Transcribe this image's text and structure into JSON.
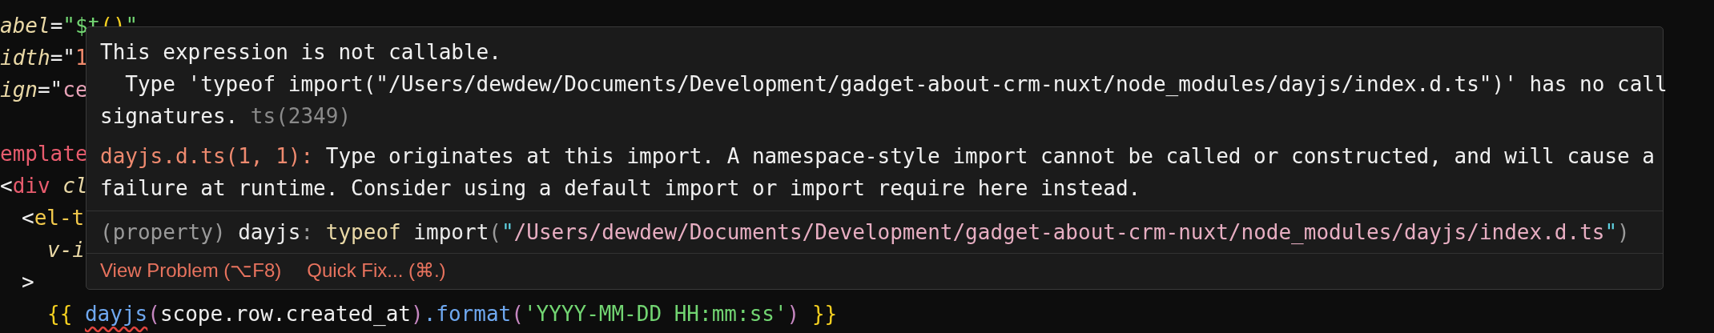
{
  "code_lines": [
    {
      "tokens": [
        {
          "kind": "attr",
          "text": "abel"
        },
        {
          "kind": "punct",
          "text": "="
        },
        {
          "kind": "string",
          "text": "\"$t"
        },
        {
          "kind": "brace",
          "text": "("
        },
        {
          "kind": "brace",
          "text": ")"
        },
        {
          "kind": "string",
          "text": "\""
        }
      ]
    },
    {
      "tokens": [
        {
          "kind": "attr",
          "text": "idth"
        },
        {
          "kind": "punct",
          "text": "=\""
        },
        {
          "kind": "number",
          "text": "1"
        }
      ]
    },
    {
      "tokens": [
        {
          "kind": "attr",
          "text": "ign"
        },
        {
          "kind": "punct",
          "text": "=\""
        },
        {
          "kind": "value",
          "text": "ce"
        }
      ]
    },
    {
      "blank_before": true,
      "tokens": [
        {
          "kind": "tag",
          "text": "emplate"
        }
      ]
    },
    {
      "tokens": [
        {
          "kind": "punct",
          "text": "<"
        },
        {
          "kind": "tag",
          "text": "div"
        },
        {
          "kind": "attr",
          "text": " cl"
        }
      ],
      "children": [
        {
          "tokens": [
            {
              "kind": "punct",
              "text": "<"
            },
            {
              "kind": "component",
              "text": "el-t"
            }
          ],
          "children": [
            {
              "tokens": [
                {
                  "kind": "attr",
                  "text": "v-i"
                }
              ]
            }
          ]
        },
        {
          "tokens": [
            {
              "kind": "punct",
              "text": ">"
            }
          ],
          "children": [
            {
              "tokens": [
                {
                  "kind": "brace",
                  "text": "{{ "
                },
                {
                  "kind": "error",
                  "text": "dayjs"
                },
                {
                  "kind": "paren",
                  "text": "("
                },
                {
                  "kind": "var",
                  "text": "scope.row.created_at"
                },
                {
                  "kind": "paren",
                  "text": ")"
                },
                {
                  "kind": "fn",
                  "text": ".format"
                },
                {
                  "kind": "paren",
                  "text": "("
                },
                {
                  "kind": "string",
                  "text": "'YYYY-MM-DD HH:mm:ss'"
                },
                {
                  "kind": "paren",
                  "text": ")"
                },
                {
                  "kind": "brace",
                  "text": " }}"
                }
              ]
            }
          ]
        }
      ]
    }
  ],
  "tooltip": {
    "message": {
      "lines": [
        "This expression is not callable.",
        "  Type 'typeof import(\"/Users/dewdew/Documents/Development/gadget-about-crm-nuxt/node_modules/dayjs/index.d.ts\")' has no call",
        "signatures."
      ],
      "code": "ts(2349)"
    },
    "related": {
      "source": "dayjs.d.ts(1, 1):",
      "lines": [
        "Type originates at this import. A namespace-style import cannot be called or constructed, and will cause a",
        "failure at runtime. Consider using a default import or import require here instead."
      ]
    },
    "hover": [
      {
        "kind": "muted",
        "text": "(property) "
      },
      {
        "kind": "name",
        "text": "dayjs"
      },
      {
        "kind": "muted",
        "text": ": "
      },
      {
        "kind": "keyword",
        "text": "typeof "
      },
      {
        "kind": "name",
        "text": "import"
      },
      {
        "kind": "muted",
        "text": "("
      },
      {
        "kind": "quote",
        "text": "\""
      },
      {
        "kind": "path",
        "text": "/Users/dewdew/Documents/Development/gadget-about-crm-nuxt/node_modules/dayjs/index.d.ts"
      },
      {
        "kind": "quote",
        "text": "\""
      },
      {
        "kind": "muted",
        "text": ")"
      }
    ],
    "actions": [
      {
        "label": "View Problem (⌥F8)"
      },
      {
        "label": "Quick Fix... (⌘.)"
      }
    ]
  }
}
